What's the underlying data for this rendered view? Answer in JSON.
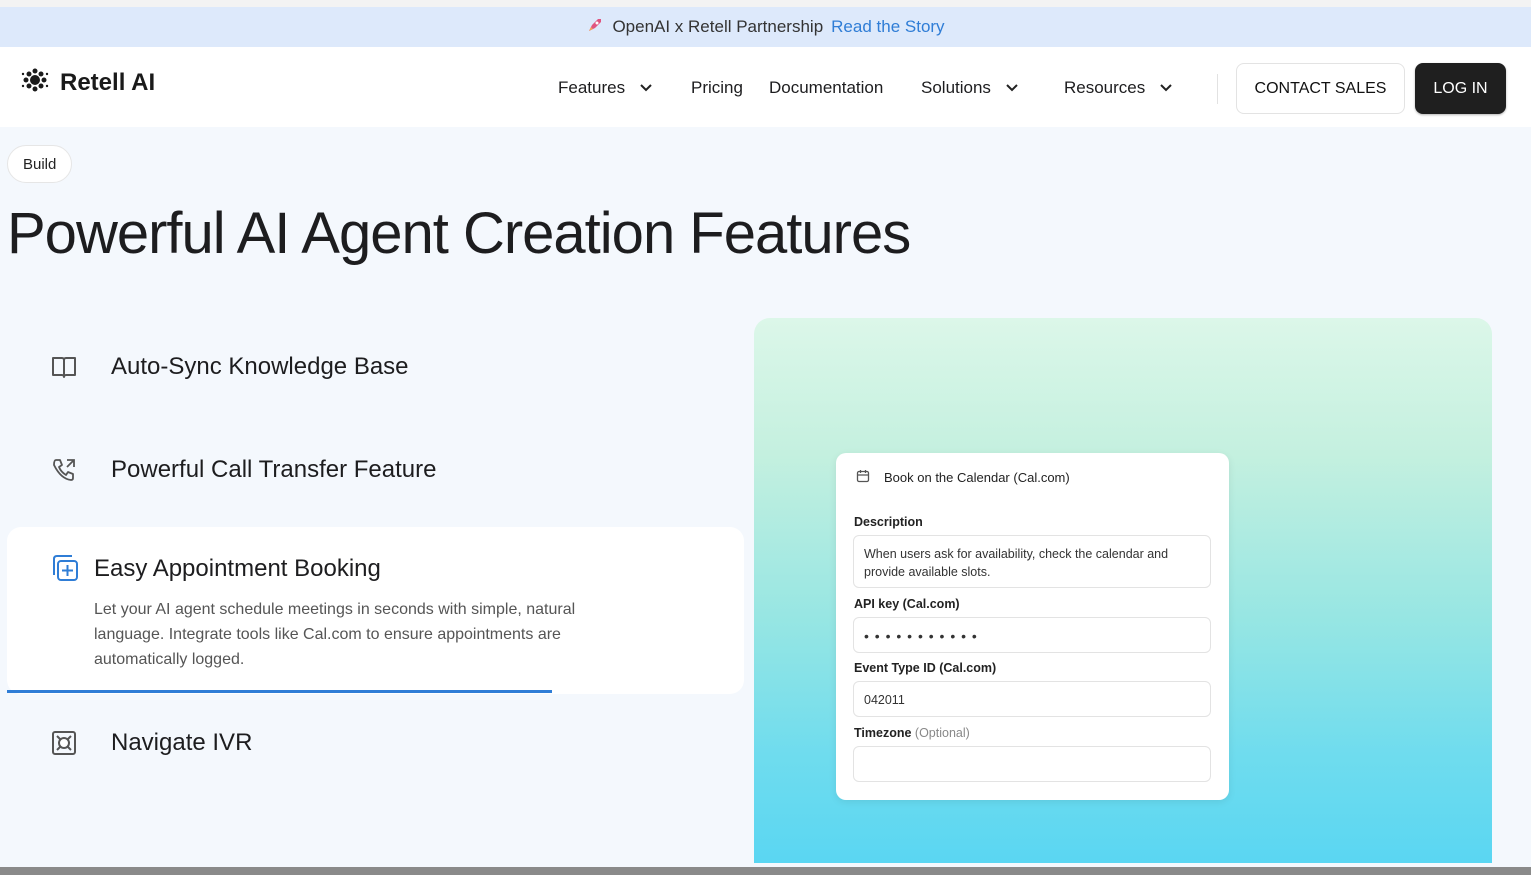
{
  "announcement": {
    "text": "OpenAI x Retell Partnership",
    "link": "Read the Story"
  },
  "header": {
    "logo": "Retell AI",
    "nav": {
      "features": "Features",
      "pricing": "Pricing",
      "documentation": "Documentation",
      "solutions": "Solutions",
      "resources": "Resources"
    },
    "contact_sales": "CONTACT SALES",
    "login": "LOG IN"
  },
  "hero": {
    "tag": "Build",
    "title": "Powerful AI Agent Creation Features"
  },
  "features": [
    {
      "label": "Auto-Sync Knowledge Base",
      "icon": "book-icon"
    },
    {
      "label": "Powerful Call Transfer Feature",
      "icon": "phone-forward-icon"
    },
    {
      "label": "Easy Appointment Booking",
      "icon": "calendar-plus-icon",
      "description": "Let your AI agent schedule meetings in seconds with simple, natural language. Integrate tools like Cal.com to ensure appointments are automatically logged.",
      "progress": 0.74
    },
    {
      "label": "Navigate IVR",
      "icon": "ivr-icon"
    }
  ],
  "demo_card": {
    "title": "Book on the Calendar (Cal.com)",
    "description_label": "Description",
    "description_value": "When users ask for availability, check the calendar and provide available slots.",
    "api_key_label": "API key (Cal.com)",
    "api_key_value": "• • • • • • • • • • •",
    "event_type_label": "Event Type ID (Cal.com)",
    "event_type_value": "042011",
    "timezone_label": "Timezone",
    "timezone_optional": "(Optional)",
    "timezone_value": ""
  },
  "colors": {
    "accent": "#2f7dd6",
    "announce_bg": "#dde9fb",
    "login_bg": "#1f1f1f"
  }
}
